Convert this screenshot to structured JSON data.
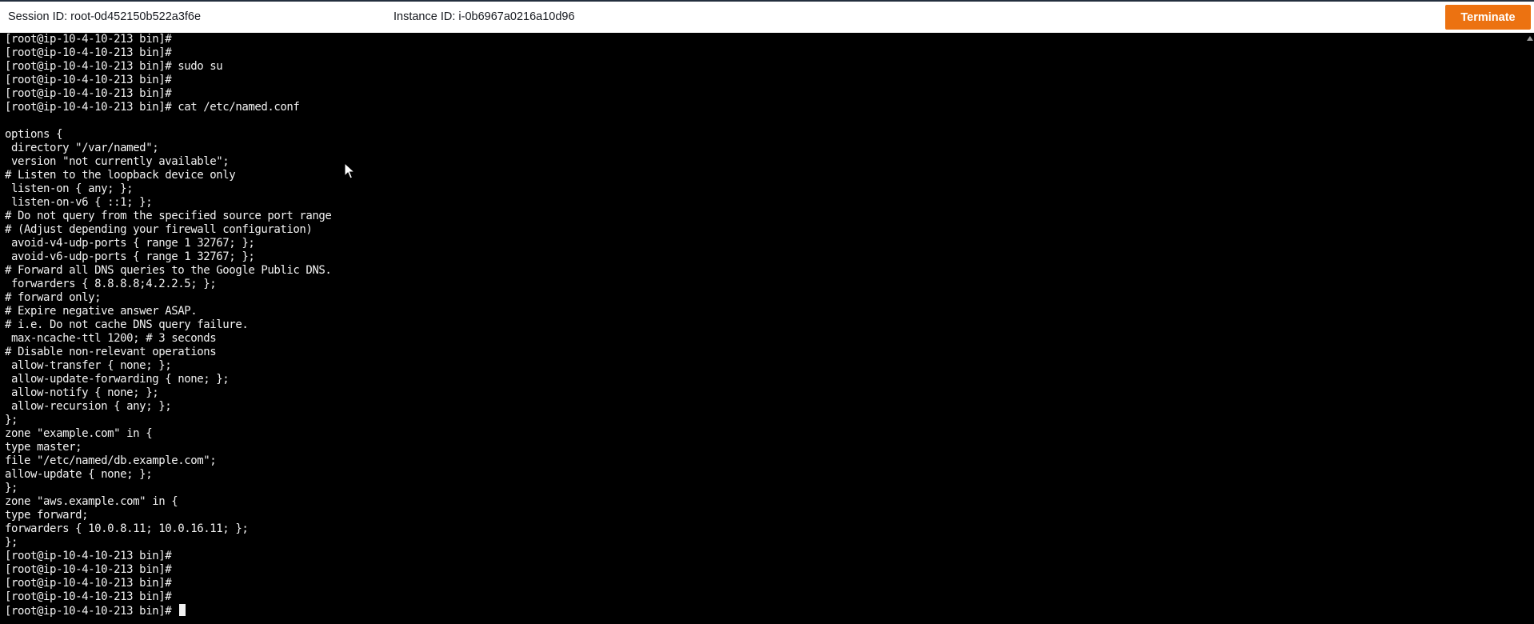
{
  "header": {
    "session_id": "Session ID: root-0d452150b522a3f6e",
    "instance_id": "Instance ID: i-0b6967a0216a10d96",
    "terminate_label": "Terminate"
  },
  "colors": {
    "accent": "#ec7211",
    "terminal_bg": "#000000",
    "terminal_fg": "#f2f2f2"
  },
  "terminal": {
    "lines": [
      "[root@ip-10-4-10-213 bin]#",
      "[root@ip-10-4-10-213 bin]#",
      "[root@ip-10-4-10-213 bin]# sudo su",
      "[root@ip-10-4-10-213 bin]#",
      "[root@ip-10-4-10-213 bin]#",
      "[root@ip-10-4-10-213 bin]# cat /etc/named.conf",
      "",
      "options {",
      " directory \"/var/named\";",
      " version \"not currently available\";",
      "# Listen to the loopback device only",
      " listen-on { any; };",
      " listen-on-v6 { ::1; };",
      "# Do not query from the specified source port range",
      "# (Adjust depending your firewall configuration)",
      " avoid-v4-udp-ports { range 1 32767; };",
      " avoid-v6-udp-ports { range 1 32767; };",
      "# Forward all DNS queries to the Google Public DNS.",
      " forwarders { 8.8.8.8;4.2.2.5; };",
      "# forward only;",
      "# Expire negative answer ASAP.",
      "# i.e. Do not cache DNS query failure.",
      " max-ncache-ttl 1200; # 3 seconds",
      "# Disable non-relevant operations",
      " allow-transfer { none; };",
      " allow-update-forwarding { none; };",
      " allow-notify { none; };",
      " allow-recursion { any; };",
      "};",
      "zone \"example.com\" in {",
      "type master;",
      "file \"/etc/named/db.example.com\";",
      "allow-update { none; };",
      "};",
      "zone \"aws.example.com\" in {",
      "type forward;",
      "forwarders { 10.0.8.11; 10.0.16.11; };",
      "};",
      "[root@ip-10-4-10-213 bin]#",
      "[root@ip-10-4-10-213 bin]#",
      "[root@ip-10-4-10-213 bin]#",
      "[root@ip-10-4-10-213 bin]#"
    ],
    "prompt_line": "[root@ip-10-4-10-213 bin]# "
  }
}
